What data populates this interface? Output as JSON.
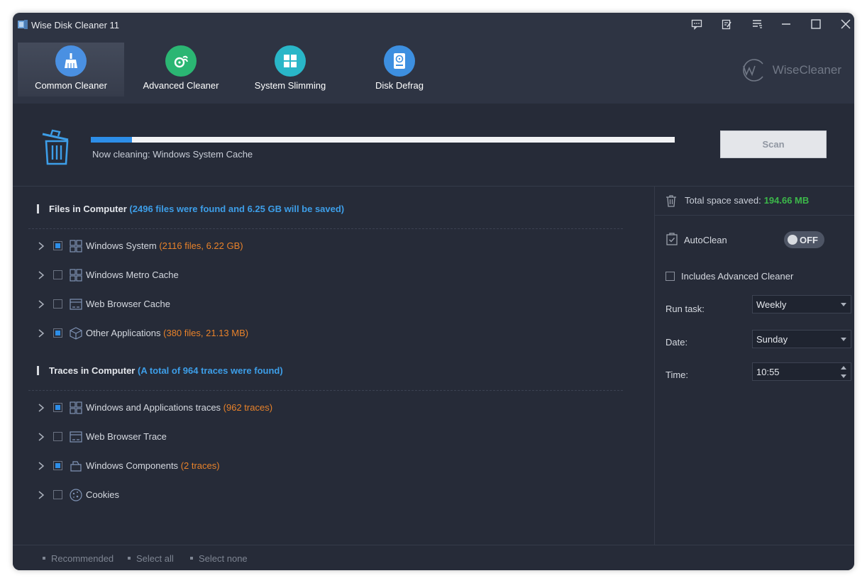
{
  "window": {
    "title": "Wise Disk Cleaner 11"
  },
  "tabs": [
    {
      "label": "Common Cleaner",
      "icon": "broom-icon",
      "color": "#4a90e2",
      "active": true
    },
    {
      "label": "Advanced Cleaner",
      "icon": "advanced-cleaner-icon",
      "color": "#2bb673",
      "active": false
    },
    {
      "label": "System Slimming",
      "icon": "windows-icon",
      "color": "#29b6c8",
      "active": false
    },
    {
      "label": "Disk Defrag",
      "icon": "disk-defrag-icon",
      "color": "#3d8fe0",
      "active": false
    }
  ],
  "brand": {
    "text": "WiseCleaner"
  },
  "progress": {
    "status": "Now cleaning: Windows System Cache",
    "percent": 7,
    "scan_label": "Scan"
  },
  "files_section": {
    "title": "Files in Computer",
    "note": "(2496 files were found and 6.25 GB will be saved)",
    "items": [
      {
        "label": "Windows System",
        "note": "(2116 files, 6.22 GB)",
        "checked": true,
        "icon": "windows-grid-icon"
      },
      {
        "label": "Windows Metro Cache",
        "note": "",
        "checked": false,
        "icon": "windows-grid-icon"
      },
      {
        "label": "Web Browser Cache",
        "note": "",
        "checked": false,
        "icon": "browser-icon"
      },
      {
        "label": "Other Applications",
        "note": "(380 files, 21.13 MB)",
        "checked": true,
        "icon": "box-icon"
      }
    ]
  },
  "traces_section": {
    "title": "Traces in Computer",
    "note": "(A total of 964 traces were found)",
    "items": [
      {
        "label": "Windows and Applications traces",
        "note": "(962 traces)",
        "checked": true,
        "icon": "windows-grid-icon"
      },
      {
        "label": "Web Browser Trace",
        "note": "",
        "checked": false,
        "icon": "browser-icon"
      },
      {
        "label": "Windows Components",
        "note": "(2 traces)",
        "checked": true,
        "icon": "components-icon"
      },
      {
        "label": "Cookies",
        "note": "",
        "checked": false,
        "icon": "cookie-icon"
      }
    ]
  },
  "right_panel": {
    "saved_label": "Total space saved:",
    "saved_value": "194.66 MB",
    "autoclean_label": "AutoClean",
    "toggle_text": "OFF",
    "includes_label": "Includes Advanced Cleaner",
    "run_task_label": "Run task:",
    "run_task_value": "Weekly",
    "date_label": "Date:",
    "date_value": "Sunday",
    "time_label": "Time:",
    "time_value": "10:55"
  },
  "footer": {
    "recommended": "Recommended",
    "select_all": "Select all",
    "select_none": "Select none"
  },
  "colors": {
    "accent": "#2d8ee8",
    "note_orange": "#e8822a",
    "saved_green": "#3cb84a",
    "section_note_blue": "#3d9ee8"
  }
}
